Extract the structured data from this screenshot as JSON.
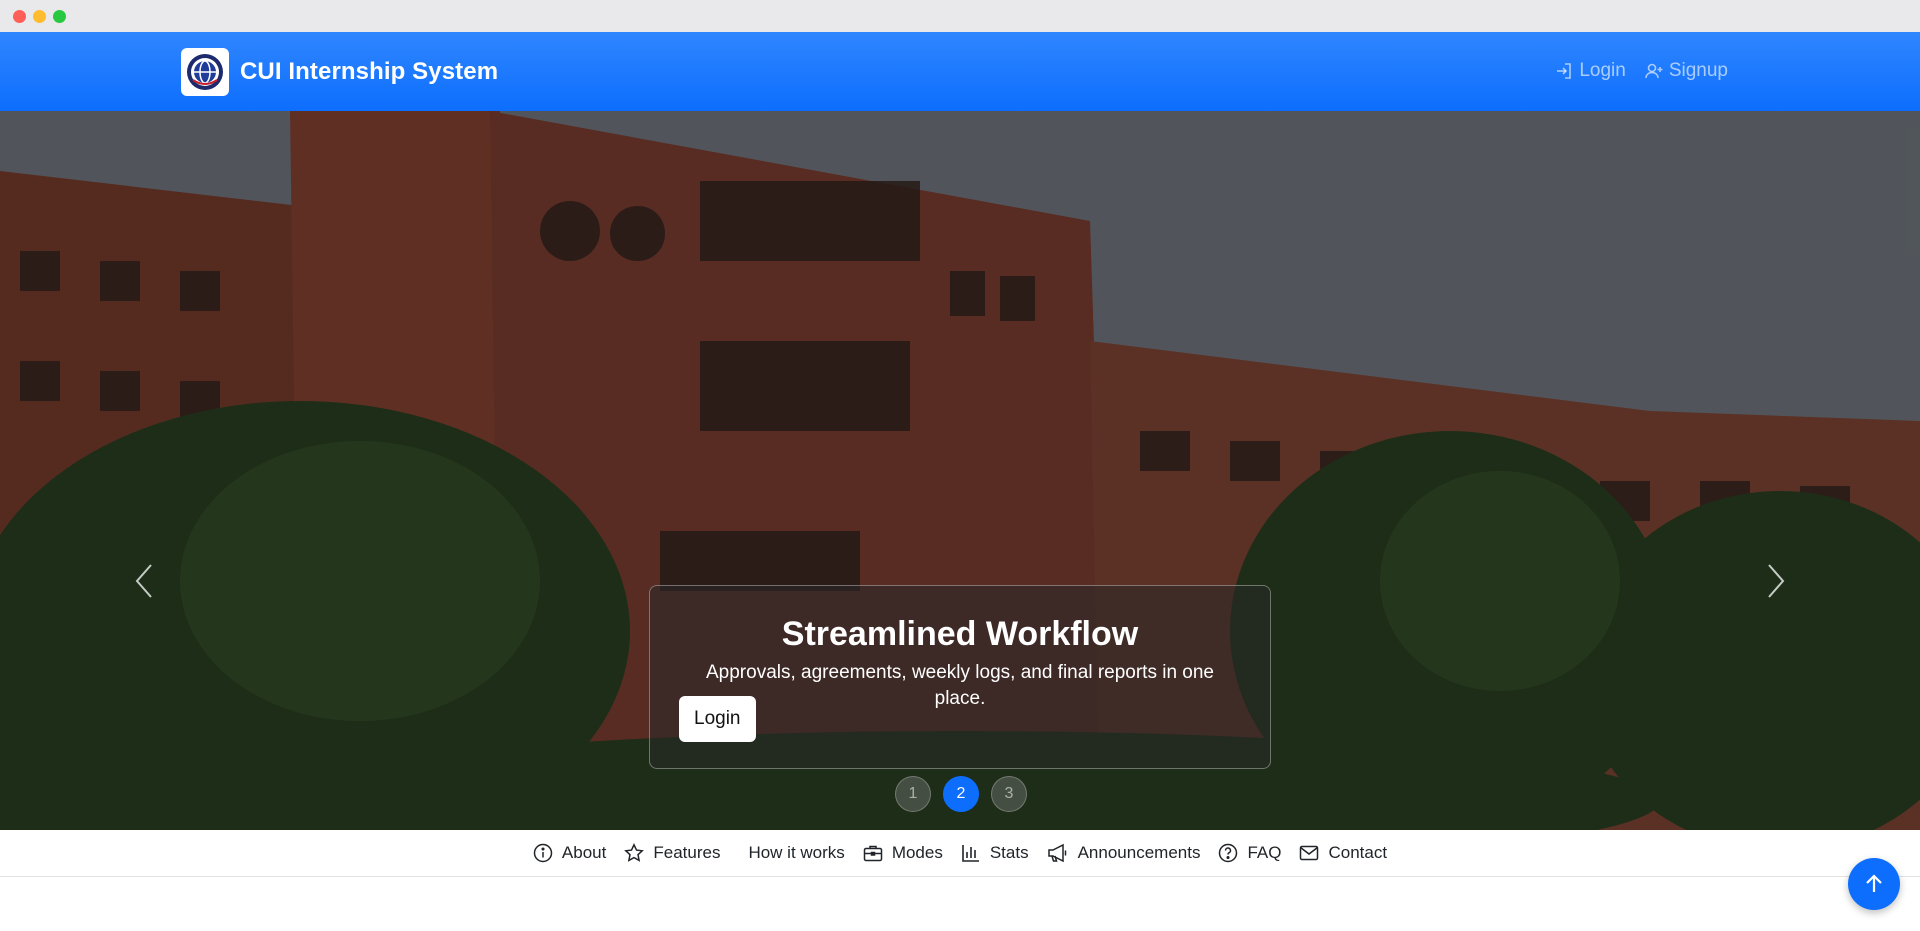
{
  "navbar": {
    "brand_title": "CUI Internship System",
    "links": [
      {
        "label": "Login",
        "icon": "login-icon"
      },
      {
        "label": "Signup",
        "icon": "user-plus-icon"
      }
    ]
  },
  "hero": {
    "caption": {
      "title": "Streamlined Workflow",
      "text": "Approvals, agreements, weekly logs, and final reports in one place.",
      "button_label": "Login"
    },
    "indicators": [
      "1",
      "2",
      "3"
    ],
    "active_indicator": "2"
  },
  "section_nav": {
    "items": [
      {
        "label": "About",
        "icon": "info-circle-icon"
      },
      {
        "label": "Features",
        "icon": "star-icon"
      },
      {
        "label": "How it works",
        "icon": ""
      },
      {
        "label": "Modes",
        "icon": "briefcase-icon"
      },
      {
        "label": "Stats",
        "icon": "bar-chart-icon"
      },
      {
        "label": "Announcements",
        "icon": "megaphone-icon"
      },
      {
        "label": "FAQ",
        "icon": "question-circle-icon"
      },
      {
        "label": "Contact",
        "icon": "envelope-icon"
      }
    ]
  },
  "colors": {
    "primary": "#0d6efd",
    "navbar_top": "#2f86ff"
  }
}
